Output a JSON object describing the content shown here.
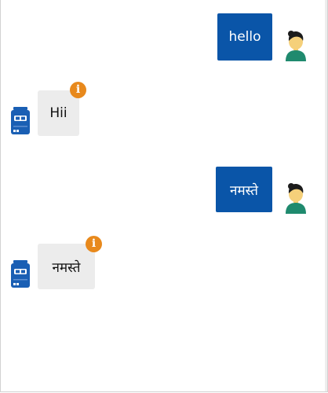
{
  "chat": {
    "messages": [
      {
        "sender": "user",
        "text": "hello",
        "avatar_icon": "user-avatar-icon"
      },
      {
        "sender": "bot",
        "text": "Hii",
        "avatar_icon": "bot-avatar-icon",
        "badge_icon": "info-icon",
        "badge_glyph": "i"
      },
      {
        "sender": "user",
        "text": "नमस्ते",
        "avatar_icon": "user-avatar-icon"
      },
      {
        "sender": "bot",
        "text": "नमस्ते",
        "avatar_icon": "bot-avatar-icon",
        "badge_icon": "info-icon",
        "badge_glyph": "i"
      }
    ]
  },
  "colors": {
    "user_bubble": "#0a55a8",
    "bot_bubble": "#ececec",
    "info_badge": "#e8891c",
    "bot_avatar": "#1a5fb4",
    "user_avatar_shirt": "#1f8a6e"
  }
}
